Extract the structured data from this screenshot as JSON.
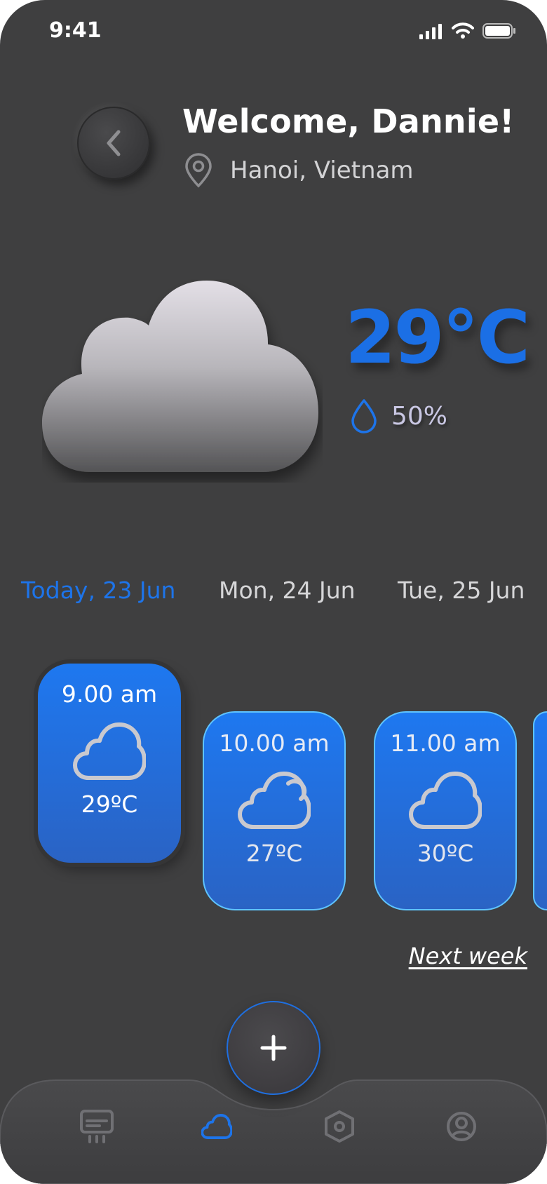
{
  "status_bar": {
    "time": "9:41"
  },
  "header": {
    "welcome": "Welcome, Dannie!",
    "location": "Hanoi, Vietnam"
  },
  "current": {
    "temperature": "29°C",
    "humidity": "50%"
  },
  "day_tabs": [
    {
      "label": "Today, 23 Jun",
      "active": true
    },
    {
      "label": "Mon, 24 Jun",
      "active": false
    },
    {
      "label": "Tue, 25 Jun",
      "active": false
    }
  ],
  "hourly": [
    {
      "time": "9.00 am",
      "temp": "29ºC",
      "icon": "cloud-icon",
      "active": true
    },
    {
      "time": "10.00 am",
      "temp": "27ºC",
      "icon": "cloud-sun-icon",
      "active": false
    },
    {
      "time": "11.00 am",
      "temp": "30ºC",
      "icon": "cloud-icon",
      "active": false
    }
  ],
  "next_week_label": "Next week",
  "bottom_nav": {
    "items": [
      "air-conditioner-icon",
      "cloud-icon",
      "settings-hex-icon",
      "profile-icon"
    ],
    "active_index": 1
  },
  "colors": {
    "accent": "#1d74ea",
    "background": "#3f3f40",
    "card_gradient_top": "#1e78f0",
    "card_gradient_bottom": "#2a63c4"
  }
}
